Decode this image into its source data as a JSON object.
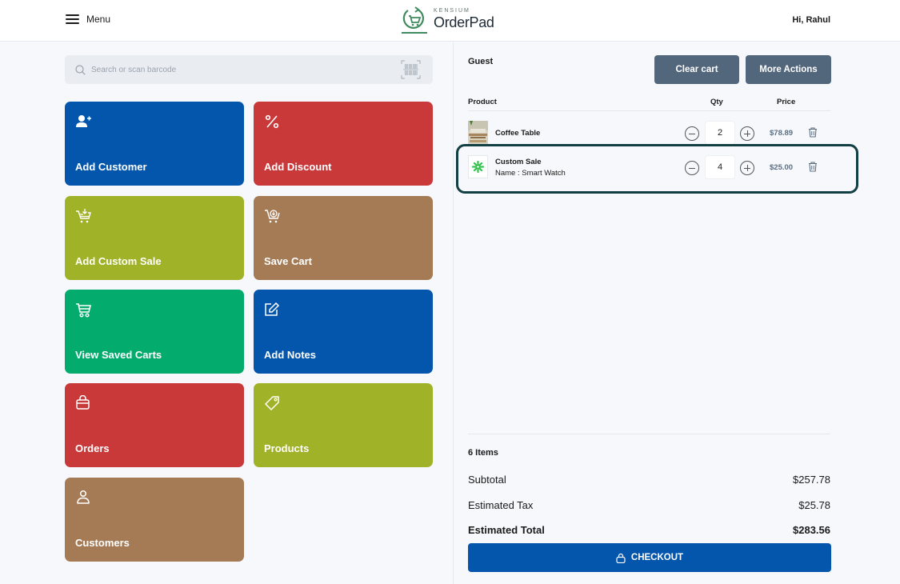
{
  "header": {
    "menu_label": "Menu",
    "logo_brand": "KENSIUM",
    "logo_name": "OrderPad",
    "greeting": "Hi, Rahul"
  },
  "search": {
    "placeholder": "Search or scan barcode",
    "value": ""
  },
  "tiles": [
    {
      "label": "Add Customer",
      "icon": "add-user-icon",
      "color": "#0456ad"
    },
    {
      "label": "Add Discount",
      "icon": "percent-icon",
      "color": "#c9393a"
    },
    {
      "label": "Add Custom Sale",
      "icon": "cart-add-icon",
      "color": "#a0b227"
    },
    {
      "label": "Save Cart",
      "icon": "cart-save-icon",
      "color": "#a57b56"
    },
    {
      "label": "View Saved Carts",
      "icon": "cart-icon",
      "color": "#03ab6c"
    },
    {
      "label": "Add Notes",
      "icon": "edit-note-icon",
      "color": "#0456ad"
    },
    {
      "label": "Orders",
      "icon": "shopping-bag-icon",
      "color": "#c9393a"
    },
    {
      "label": "Products",
      "icon": "tag-icon",
      "color": "#a0b227"
    },
    {
      "label": "Customers",
      "icon": "user-icon",
      "color": "#a57b56"
    }
  ],
  "cart": {
    "customer": "Guest",
    "clear_label": "Clear cart",
    "more_label": "More Actions",
    "columns": {
      "product": "Product",
      "qty": "Qty",
      "price": "Price"
    },
    "items": [
      {
        "name": "Coffee Table",
        "subtitle": "",
        "qty": "2",
        "price": "$78.89",
        "thumb": "coffee-table-thumbnail"
      },
      {
        "name": "Custom Sale",
        "subtitle": "Name : Smart Watch",
        "qty": "4",
        "price": "$25.00",
        "thumb": "custom-sale-thumbnail"
      }
    ],
    "summary": {
      "items_count": "6 Items",
      "subtotal_label": "Subtotal",
      "subtotal": "$257.78",
      "tax_label": "Estimated Tax",
      "tax": "$25.78",
      "total_label": "Estimated Total",
      "total": "$283.56"
    },
    "checkout_label": "CHECKOUT"
  },
  "colors": {
    "primary": "#0456ad",
    "slate_button": "#52667c",
    "highlight_border": "#123f43",
    "logo_green": "#3f8a5e"
  }
}
